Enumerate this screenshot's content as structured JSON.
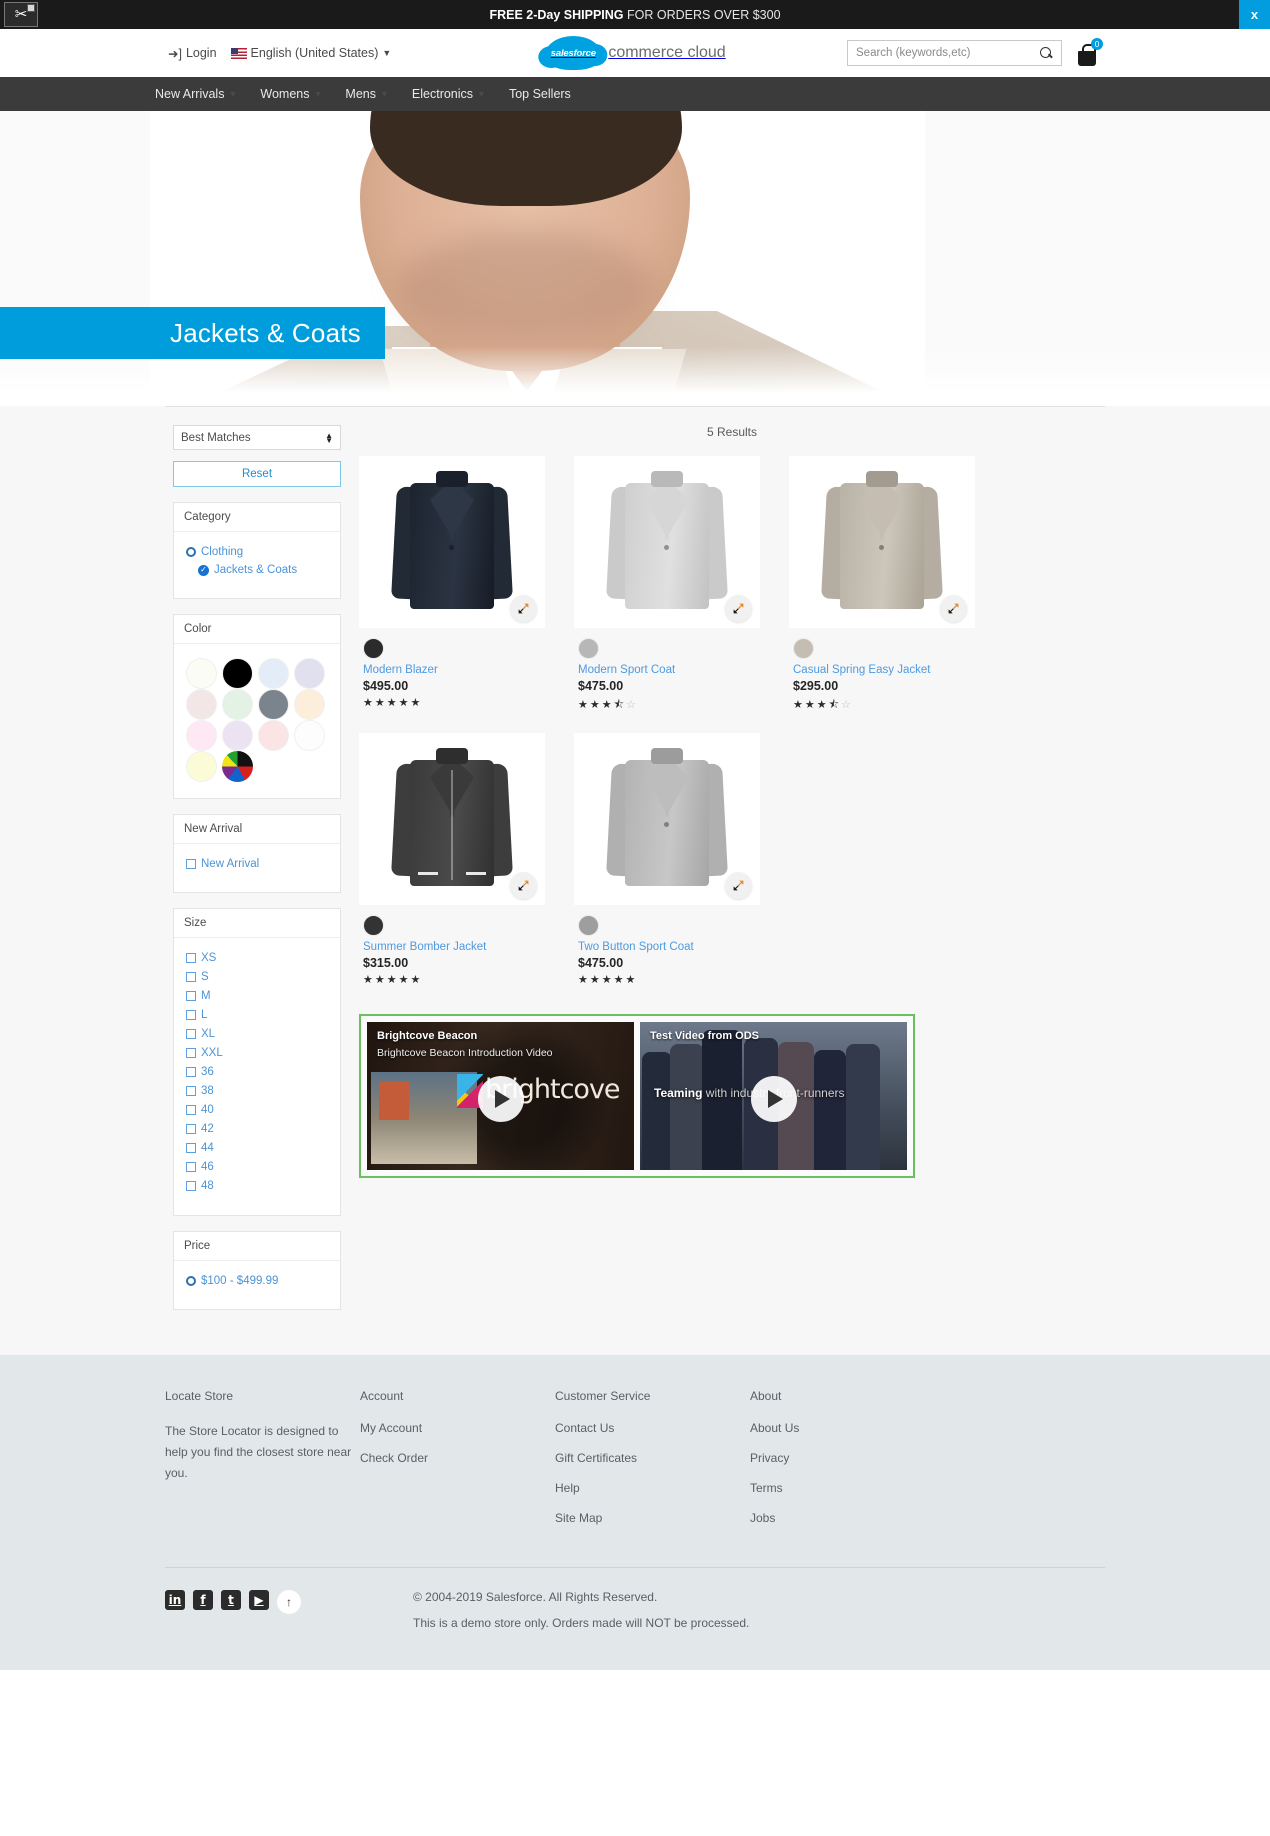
{
  "promo": {
    "text_bold": "FREE 2-Day SHIPPING",
    "text_light": " FOR ORDERS OVER $300",
    "close_label": "x",
    "extension_icon": "tools-icon"
  },
  "header": {
    "login_label": "Login",
    "locale_label": "English (United States)",
    "brand_mark": "salesforce",
    "brand_name": "commerce cloud",
    "search_placeholder": "Search (keywords,etc)",
    "search_value": "",
    "cart_count": "0"
  },
  "nav": {
    "items": [
      {
        "label": "New Arrivals",
        "has_caret": true
      },
      {
        "label": "Womens",
        "has_caret": true
      },
      {
        "label": "Mens",
        "has_caret": true
      },
      {
        "label": "Electronics",
        "has_caret": true
      },
      {
        "label": "Top Sellers",
        "has_caret": false
      }
    ]
  },
  "hero": {
    "title": "Jackets & Coats",
    "banner_color": "#009ddc"
  },
  "sidebar": {
    "sort_value": "Best Matches",
    "reset_label": "Reset",
    "category": {
      "title": "Category",
      "items": [
        {
          "label": "Clothing",
          "state": "radio"
        },
        {
          "label": "Jackets & Coats",
          "state": "checked"
        }
      ]
    },
    "color": {
      "title": "Color",
      "swatches": [
        "#fbfcf4",
        "#000000",
        "#e3ecf7",
        "#e0e0ef",
        "#f3e6e6",
        "#e4f1e5",
        "#7b848c",
        "#fdeedc",
        "#fde8f4",
        "#ece3f2",
        "#fbe4e4",
        "#fdfdfd",
        "#fcfbd7",
        "rainbow"
      ]
    },
    "new_arrival": {
      "title": "New Arrival",
      "items": [
        {
          "label": "New Arrival",
          "state": "unchecked"
        }
      ]
    },
    "size": {
      "title": "Size",
      "items": [
        "XS",
        "S",
        "M",
        "L",
        "XL",
        "XXL",
        "36",
        "38",
        "40",
        "42",
        "44",
        "46",
        "48"
      ]
    },
    "price": {
      "title": "Price",
      "items": [
        {
          "label": "$100 - $499.99",
          "state": "radio"
        }
      ]
    }
  },
  "results": {
    "count_label": "5 Results",
    "products": [
      {
        "name": "Modern Blazer",
        "price": "$495.00",
        "rating": 5,
        "swatch": "#2b2b2b",
        "art": "blazer-navy"
      },
      {
        "name": "Modern Sport Coat",
        "price": "$475.00",
        "rating": 3.5,
        "swatch": "#b7b7b7",
        "art": "coat-lightgrey"
      },
      {
        "name": "Casual Spring Easy Jacket",
        "price": "$295.00",
        "rating": 3.5,
        "swatch": "#c4bdb2",
        "art": "jacket-taupe"
      },
      {
        "name": "Summer Bomber Jacket",
        "price": "$315.00",
        "rating": 5,
        "swatch": "#333333",
        "art": "bomber-dark"
      },
      {
        "name": "Two Button Sport Coat",
        "price": "$475.00",
        "rating": 5,
        "swatch": "#9e9e9e",
        "art": "coat-grey"
      }
    ]
  },
  "videos": {
    "border_color": "#6abf5e",
    "items": [
      {
        "title": "Brightcove Beacon",
        "subtitle": "Brightcove Beacon Introduction Video",
        "logo_text": "brightcove"
      },
      {
        "title": "Test Video from ODS",
        "caption_bold": "Teaming",
        "caption_rest": " with industry front-runners"
      }
    ]
  },
  "footer": {
    "columns": [
      {
        "title": "Locate Store",
        "text": "The Store Locator is designed to help you find the closest store near you.",
        "links": []
      },
      {
        "title": "Account",
        "text": "",
        "links": [
          "My Account",
          "Check Order"
        ]
      },
      {
        "title": "Customer Service",
        "text": "",
        "links": [
          "Contact Us",
          "Gift Certificates",
          "Help",
          "Site Map"
        ]
      },
      {
        "title": "About",
        "text": "",
        "links": [
          "About Us",
          "Privacy",
          "Terms",
          "Jobs"
        ]
      }
    ],
    "social": [
      {
        "name": "linkedin-icon",
        "glyph": "in"
      },
      {
        "name": "facebook-icon",
        "glyph": "f"
      },
      {
        "name": "twitter-icon",
        "glyph": "t"
      },
      {
        "name": "youtube-icon",
        "glyph": "▶"
      }
    ],
    "back_to_top": "↑",
    "copyright": "© 2004-2019 Salesforce. All Rights Reserved.",
    "disclaimer": "This is a demo store only. Orders made will NOT be processed."
  }
}
